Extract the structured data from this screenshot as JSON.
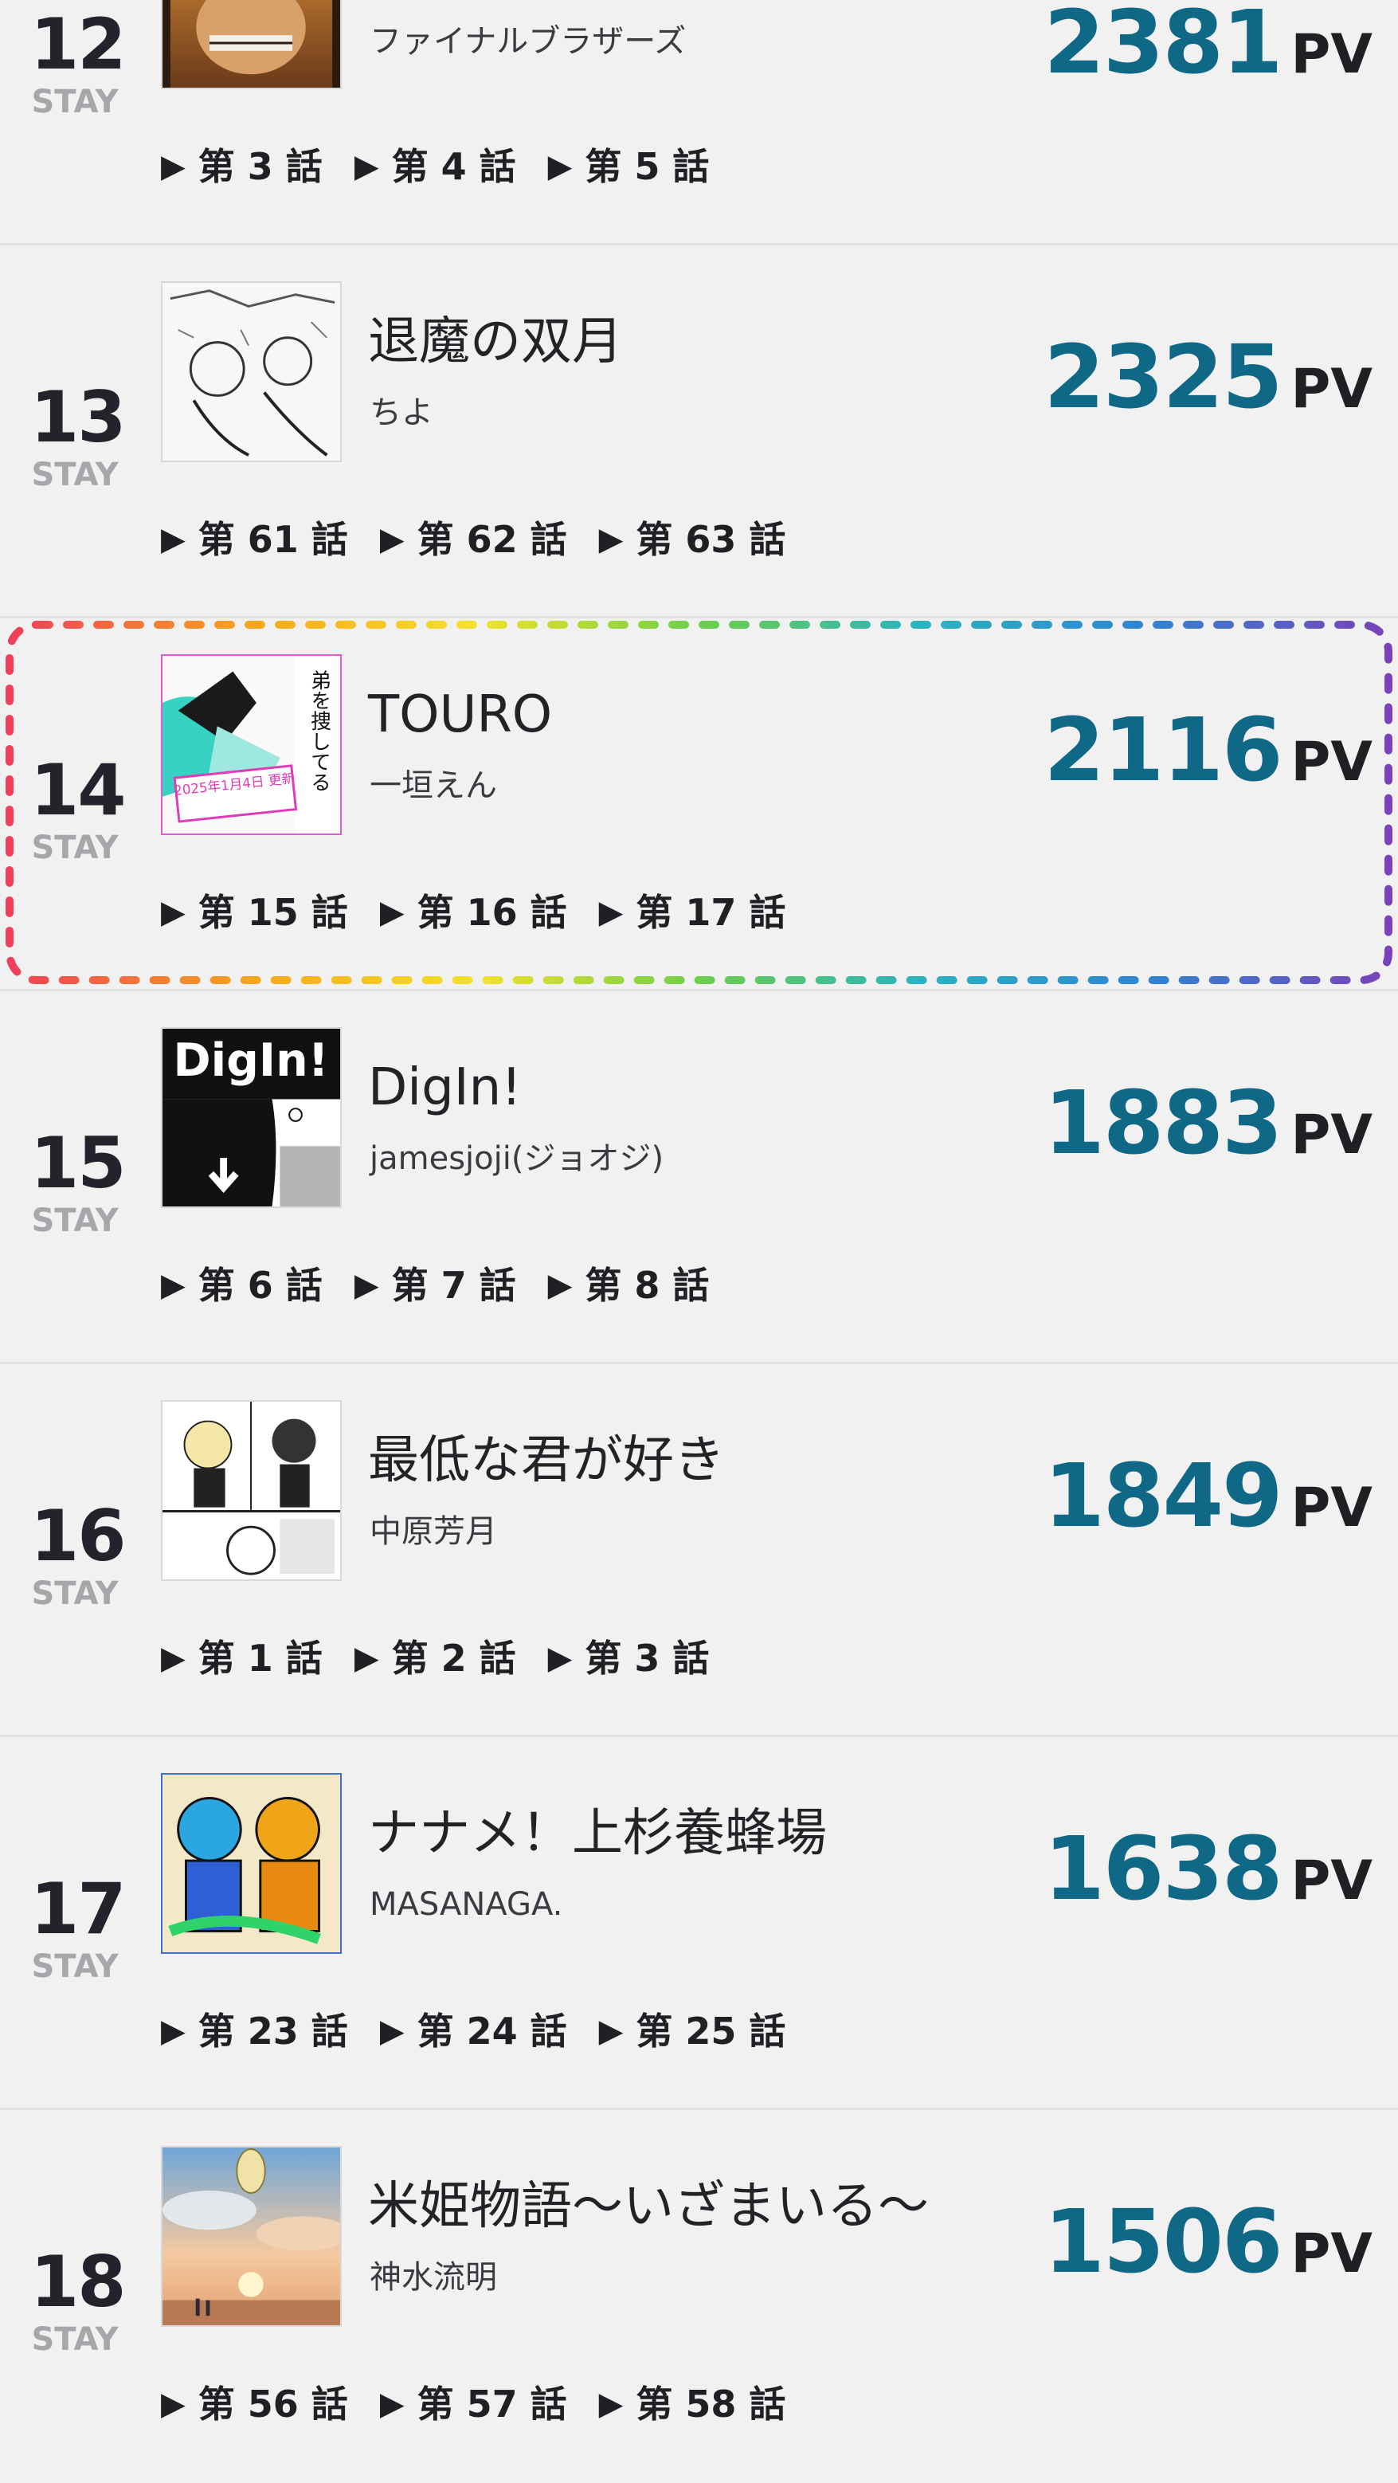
{
  "rankings": [
    {
      "rank": "12",
      "status": "STAY",
      "title": "",
      "author": "ファイナルブラザーズ",
      "pv_count": "2381",
      "pv_unit": "PV",
      "episodes": [
        "第 3 話",
        "第 4 話",
        "第 5 話"
      ],
      "thumb_icon": "manga-cover-thumbnail"
    },
    {
      "rank": "13",
      "status": "STAY",
      "title": "退魔の双月",
      "author": "ちよ",
      "pv_count": "2325",
      "pv_unit": "PV",
      "episodes": [
        "第 61 話",
        "第 62 話",
        "第 63 話"
      ],
      "thumb_icon": "manga-cover-thumbnail"
    },
    {
      "rank": "14",
      "status": "STAY",
      "title": "TOURO",
      "author": "一垣えん",
      "pv_count": "2116",
      "pv_unit": "PV",
      "episodes": [
        "第 15 話",
        "第 16 話",
        "第 17 話"
      ],
      "thumb_icon": "manga-cover-thumbnail",
      "thumb_caption": "弟を捜してる",
      "thumb_badge": "2025年1月4日 更新",
      "highlighted": true
    },
    {
      "rank": "15",
      "status": "STAY",
      "title": "DigIn!",
      "author": "jamesjoji(ジョオジ)",
      "pv_count": "1883",
      "pv_unit": "PV",
      "episodes": [
        "第 6 話",
        "第 7 話",
        "第 8 話"
      ],
      "thumb_icon": "manga-cover-thumbnail",
      "thumb_caption": "DigIn!"
    },
    {
      "rank": "16",
      "status": "STAY",
      "title": "最低な君が好き",
      "author": "中原芳月",
      "pv_count": "1849",
      "pv_unit": "PV",
      "episodes": [
        "第 1 話",
        "第 2 話",
        "第 3 話"
      ],
      "thumb_icon": "manga-cover-thumbnail"
    },
    {
      "rank": "17",
      "status": "STAY",
      "title": "ナナメ！上杉養蜂場",
      "author": "MASANAGA.",
      "pv_count": "1638",
      "pv_unit": "PV",
      "episodes": [
        "第 23 話",
        "第 24 話",
        "第 25 話"
      ],
      "thumb_icon": "manga-cover-thumbnail"
    },
    {
      "rank": "18",
      "status": "STAY",
      "title": "米姫物語〜いざまいる〜",
      "author": "神水流明",
      "pv_count": "1506",
      "pv_unit": "PV",
      "episodes": [
        "第 56 話",
        "第 57 話",
        "第 58 話"
      ],
      "thumb_icon": "manga-cover-thumbnail"
    }
  ],
  "colors": {
    "pv_accent": "#0f6886",
    "status_gray": "#a6a6ab",
    "background": "#f1f1f2",
    "highlight_gradient": [
      "#ef3f5a",
      "#f7a81b",
      "#f3e22a",
      "#6dcf4a",
      "#2bb3c0",
      "#2f86d3",
      "#7a42b8"
    ]
  }
}
